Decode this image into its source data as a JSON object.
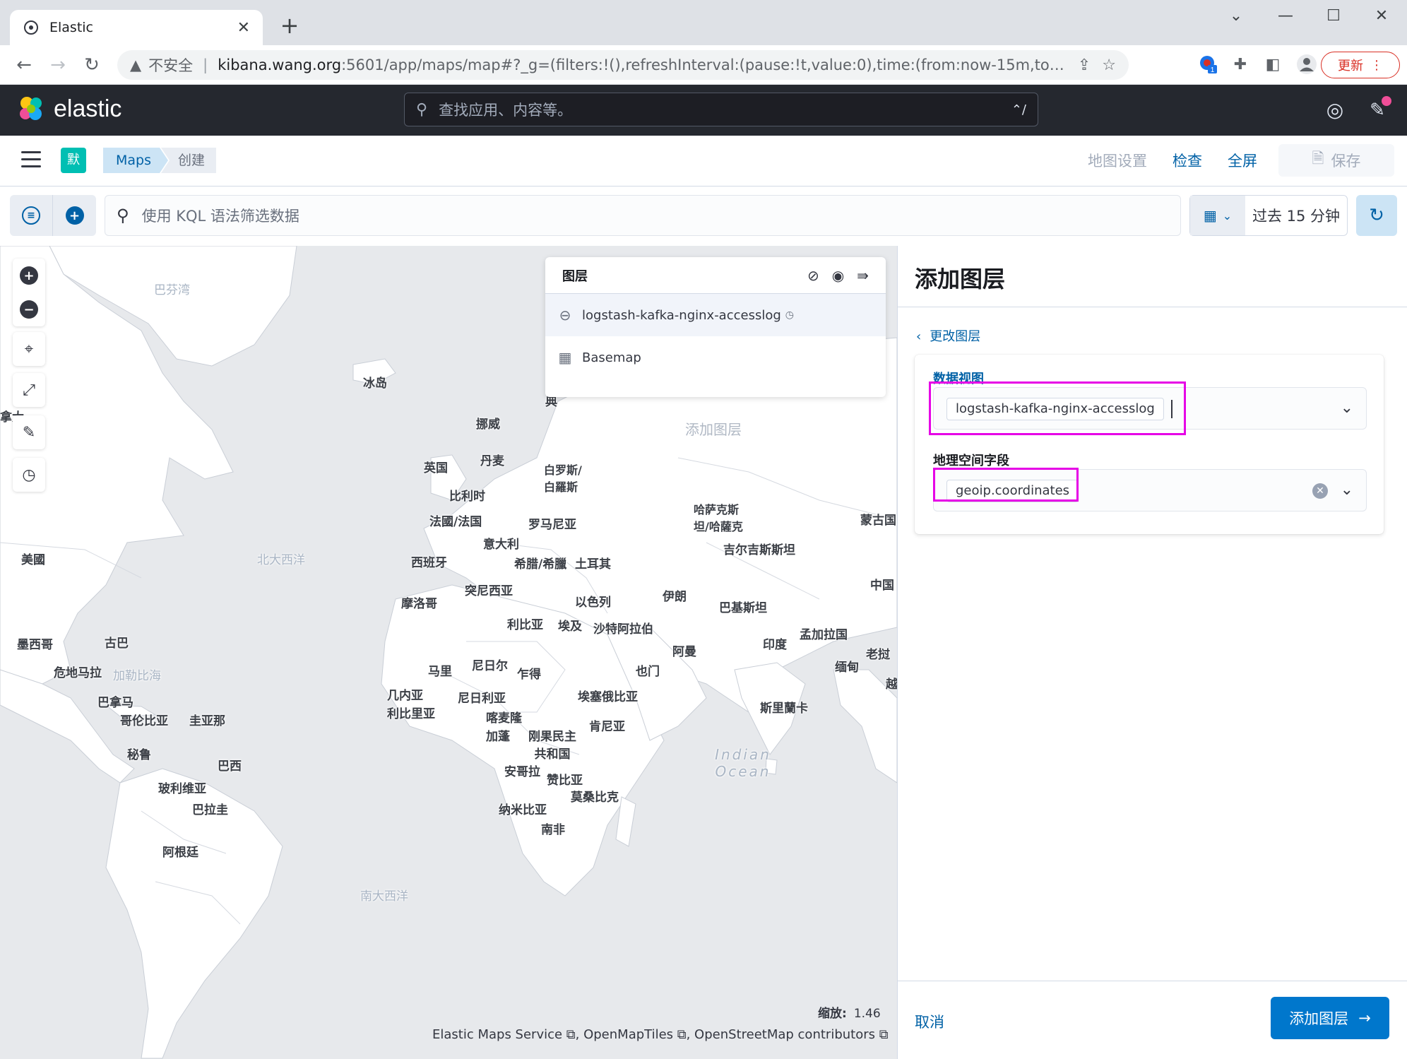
{
  "browser": {
    "tab_title": "Elastic",
    "insecure_label": "不安全",
    "url_host": "kibana.wang.org",
    "url_path": ":5601/app/maps/map#?_g=(filters:!(),refreshInterval:(pause:!t,value:0),time:(from:now-15m,to:now))&_a=(filt...",
    "update_label": "更新",
    "ext_badge": "1"
  },
  "kibana": {
    "brand": "elastic",
    "search_placeholder": "查找应用、内容等。",
    "search_shortcut": "⌃/"
  },
  "breadcrumbs": {
    "space_initial": "默",
    "items": [
      "Maps",
      "创建"
    ]
  },
  "top_nav": {
    "map_settings": "地图设置",
    "inspect": "检查",
    "fullscreen": "全屏",
    "save": "保存"
  },
  "query": {
    "placeholder": "使用 KQL 语法筛选数据",
    "time_range": "过去 15 分钟"
  },
  "legend": {
    "title": "图层",
    "layers": [
      {
        "name": "logstash-kafka-nginx-accesslog",
        "icon": "minus-circle-icon"
      },
      {
        "name": "Basemap",
        "icon": "grid-icon"
      }
    ]
  },
  "map": {
    "ghost_add_layer": "添加图层",
    "scale_label": "缩放:",
    "scale_value": "1.46",
    "attribution": "Elastic Maps Service ⧉, OpenMapTiles ⧉, OpenStreetMap contributors ⧉",
    "labels": {
      "baffin_bay": "巴芬湾",
      "iceland": "冰岛",
      "canada_partial": "拿大",
      "norway": "挪威",
      "sweden_partial": "典",
      "denmark": "丹麦",
      "uk": "英国",
      "belarus": "白罗斯/白羅斯",
      "belgium": "比利时",
      "france": "法國/法国",
      "romania": "罗马尼亚",
      "italy": "意大利",
      "spain": "西班牙",
      "greece": "希腊/希臘",
      "turkey": "土耳其",
      "kazakhstan": "哈萨克斯坦/哈薩克",
      "kyrgyzstan": "吉尔吉斯斯坦",
      "mongolia": "蒙古国",
      "china": "中国",
      "usa": "美國",
      "north_atlantic": "北大西洋",
      "tunisia": "突尼西亚",
      "morocco": "摩洛哥",
      "israel": "以色列",
      "iran": "伊朗",
      "pakistan": "巴基斯坦",
      "libya": "利比亚",
      "egypt": "埃及",
      "saudi": "沙特阿拉伯",
      "india": "印度",
      "bangladesh": "孟加拉国",
      "laos": "老挝",
      "oman": "阿曼",
      "myanmar": "缅甸",
      "vietnam_partial": "越",
      "mexico": "墨西哥",
      "cuba": "古巴",
      "guatemala": "危地马拉",
      "caribbean": "加勒比海",
      "mali": "马里",
      "niger": "尼日尔",
      "chad": "乍得",
      "yemen": "也门",
      "guinea": "几内亚",
      "liberia": "利比里亚",
      "nigeria": "尼日利亚",
      "ethiopia": "埃塞俄比亚",
      "sri_lanka": "斯里蘭卡",
      "panama": "巴拿马",
      "colombia": "哥伦比亚",
      "guyana": "圭亚那",
      "cameroon": "喀麦隆",
      "gabon": "加蓬",
      "drc": "刚果民主共和国",
      "kenya": "肯尼亚",
      "indian_ocean": "Indian Ocean",
      "peru": "秘鲁",
      "brazil": "巴西",
      "angola": "安哥拉",
      "zambia": "赞比亚",
      "bolivia": "玻利维亚",
      "mozambique": "莫桑比克",
      "paraguay": "巴拉圭",
      "namibia": "纳米比亚",
      "south_africa": "南非",
      "argentina": "阿根廷",
      "south_atlantic": "南大西洋"
    }
  },
  "panel": {
    "title": "添加图层",
    "change_layer": "更改图层",
    "data_view_label": "数据视图",
    "data_view_value": "logstash-kafka-nginx-accesslog",
    "geo_field_label": "地理空间字段",
    "geo_field_value": "geoip.coordinates",
    "cancel": "取消",
    "add_layer": "添加图层"
  },
  "colors": {
    "primary": "#0077cc",
    "header_bg": "#25282f",
    "highlight": "#e600e6",
    "map_land": "#ffffff",
    "map_sea": "#e7e9ec"
  }
}
